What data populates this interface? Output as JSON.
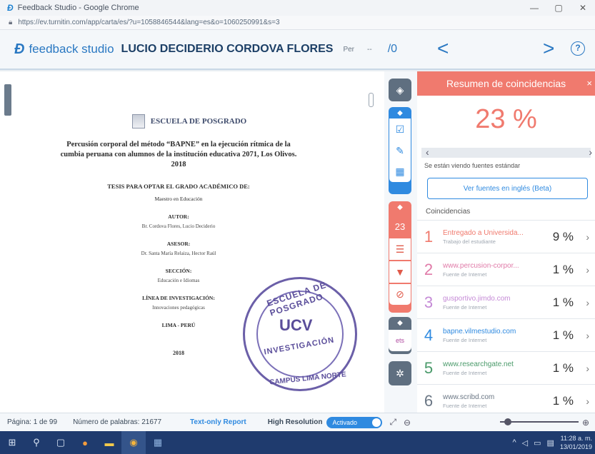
{
  "window": {
    "title": "Feedback Studio - Google Chrome",
    "favicon": "feedback-studio-logo",
    "controls": [
      "—",
      "▢",
      "✕"
    ]
  },
  "browser": {
    "url": "https://ev.turnitin.com/app/carta/es/?u=1058846544&lang=es&o=1060250991&s=3"
  },
  "header": {
    "brand": "feedback studio",
    "student": "LUCIO DECIDERIO CORDOVA FLORES",
    "per": "Per",
    "dashes": "--",
    "grade": "/0",
    "prev": "<",
    "next": ">",
    "help": "?"
  },
  "document": {
    "school": "ESCUELA DE POSGRADO",
    "thesis_title": "Percusión corporal del método “BAPNE” en la ejecución rítmica de la cumbia peruana con alumnos de la institución educativa 2071, Los Olivos. 2018",
    "degree_heading": "TESIS PARA OPTAR EL GRADO ACADÉMICO DE:",
    "degree": "Maestro en Educación",
    "author_heading": "AUTOR:",
    "author": "Br. Cordova Flores, Lucio Deciderio",
    "advisor_heading": "ASESOR:",
    "advisor": "Dr. Santa María Relaiza, Hector Raúl",
    "section_heading": "SECCIÓN:",
    "section": "Educación e Idiomas",
    "line_heading": "LÍNEA DE INVESTIGACIÓN:",
    "line": "Innovaciones pedagógicas",
    "city": "LIMA - PERÚ",
    "year": "2018",
    "stamp": {
      "top": "ESCUELA DE POSGRADO",
      "center": "UCV",
      "middle": "INVESTIGACIÓN",
      "bottom": "CAMPUS LIMA NORTE"
    }
  },
  "toolbar": {
    "layers_icon": "layers-icon",
    "grading_icon": "check-icon",
    "edit_icon": "edit-icon",
    "grid_icon": "grid-icon",
    "similarity_count": "23",
    "filter_icon": "filter-icon",
    "funnel_icon": "funnel-icon",
    "exclude_icon": "exclude-icon",
    "ets_icon": "ets-icon",
    "settings_icon": "gear-icon"
  },
  "panel": {
    "title": "Resumen de coincidencias",
    "close": "×",
    "percentage": "23 %",
    "viewing": "Se están viendo fuentes estándar",
    "english_button": "Ver fuentes en inglés (Beta)",
    "coinc_label": "Coincidencias",
    "sources": [
      {
        "num": "1",
        "name": "Entregado a Universida...",
        "kind": "Trabajo del estudiante",
        "pct": "9 %",
        "color": "#f07a6e"
      },
      {
        "num": "2",
        "name": "www.percusion-corpor...",
        "kind": "Fuente de Internet",
        "pct": "1 %",
        "color": "#e07aa8"
      },
      {
        "num": "3",
        "name": "gusportivo.jimdo.com",
        "kind": "Fuente de Internet",
        "pct": "1 %",
        "color": "#c58ad6"
      },
      {
        "num": "4",
        "name": "bapne.vilmestudio.com",
        "kind": "Fuente de Internet",
        "pct": "1 %",
        "color": "#2f8ae0"
      },
      {
        "num": "5",
        "name": "www.researchgate.net",
        "kind": "Fuente de Internet",
        "pct": "1 %",
        "color": "#4a9a6a"
      },
      {
        "num": "6",
        "name": "www.scribd.com",
        "kind": "Fuente de Internet",
        "pct": "1 %",
        "color": "#6b7785"
      }
    ]
  },
  "status": {
    "page": "Página: 1 de 99",
    "words": "Número de palabras: 21677",
    "text_only": "Text-only Report",
    "high_res": "High Resolution",
    "toggle": "Activado"
  },
  "taskbar": {
    "time": "11:28 a. m.",
    "date": "13/01/2019"
  },
  "colors": {
    "accent": "#2f8ae0",
    "match": "#f07a6e"
  }
}
